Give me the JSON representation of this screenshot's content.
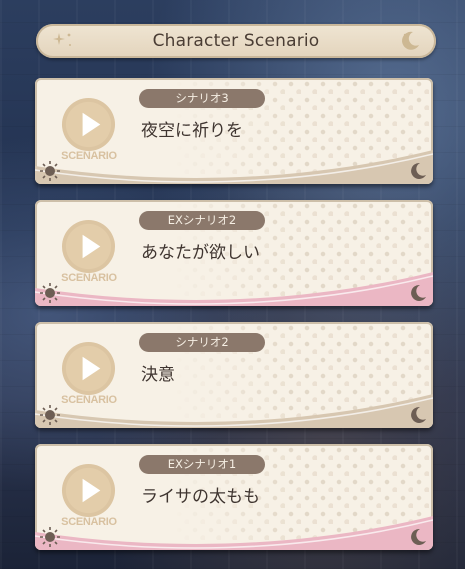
{
  "header": {
    "title": "Character Scenario"
  },
  "scenarios": [
    {
      "tag": "シナリオ3",
      "title": "夜空に祈りを",
      "play_label": "SCENARIO",
      "wave_color": "#d7c7b1",
      "accent": "normal"
    },
    {
      "tag": "EXシナリオ2",
      "title": "あなたが欲しい",
      "play_label": "SCENARIO",
      "wave_color": "#ebb7c4",
      "accent": "pink"
    },
    {
      "tag": "シナリオ2",
      "title": "決意",
      "play_label": "SCENARIO",
      "wave_color": "#d7c7b1",
      "accent": "normal"
    },
    {
      "tag": "EXシナリオ1",
      "title": "ライサの太もも",
      "play_label": "SCENARIO",
      "wave_color": "#ebb7c4",
      "accent": "pink"
    }
  ],
  "icons": {
    "play": "play-icon",
    "sun": "sun-icon",
    "moon": "moon-icon",
    "star": "star-icon"
  },
  "colors": {
    "card_bg": "#f7f1e6",
    "tag_bg": "#8b786b",
    "title_text": "#3f3530",
    "play_circle": "#d9c29f",
    "pink_accent": "#ebb7c4",
    "beige_accent": "#d7c7b1"
  }
}
